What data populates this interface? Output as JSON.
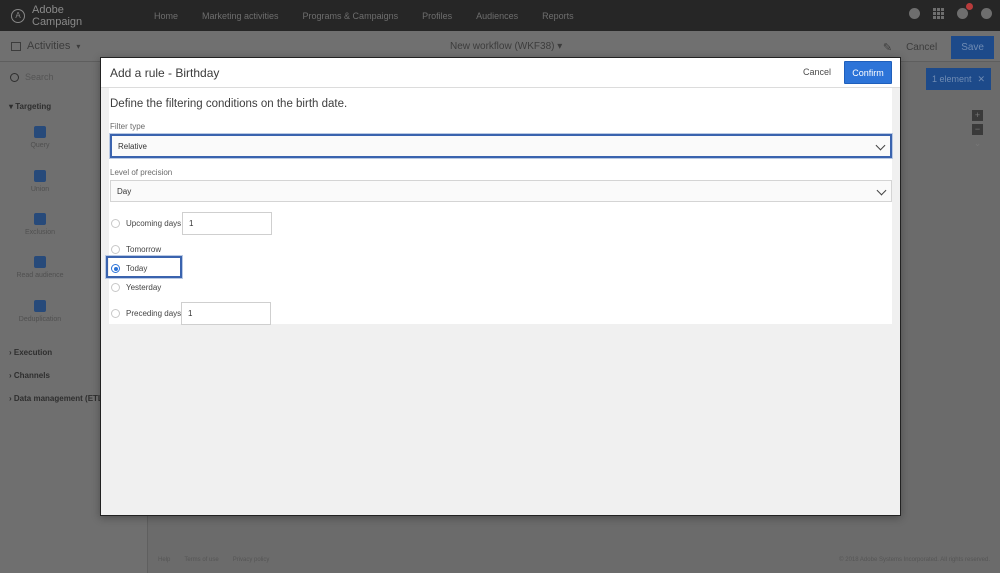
{
  "app": {
    "name": "Adobe Campaign",
    "nav": [
      "Home",
      "Marketing activities",
      "Programs & Campaigns",
      "Profiles",
      "Audiences",
      "Reports"
    ]
  },
  "workflow": {
    "activities_label": "Activities",
    "title": "New workflow (WKF38)",
    "cancel_label": "Cancel",
    "save_label": "Save",
    "search_placeholder": "Search",
    "element_button": "1 element",
    "sections": {
      "targeting": "Targeting",
      "execution": "Execution",
      "channels": "Channels",
      "data_management": "Data management (ETL)"
    },
    "palette": [
      "Query",
      "Union",
      "Exclusion",
      "Read audience",
      "Deduplication"
    ],
    "footer_links": [
      "Help",
      "Terms of use",
      "Privacy policy"
    ],
    "footer_right": "© 2018 Adobe Systems Incorporated. All rights reserved."
  },
  "modal": {
    "title": "Add a rule - Birthday",
    "cancel_label": "Cancel",
    "confirm_label": "Confirm",
    "intro": "Define the filtering conditions on the birth date.",
    "filter_type_label": "Filter type",
    "filter_type_value": "Relative",
    "precision_label": "Level of precision",
    "precision_value": "Day",
    "options": {
      "upcoming_days": "Upcoming days",
      "upcoming_days_value": "1",
      "tomorrow": "Tomorrow",
      "today": "Today",
      "yesterday": "Yesterday",
      "preceding_days": "Preceding days",
      "preceding_days_value": "1"
    },
    "selected_option": "today"
  },
  "colors": {
    "primary_blue": "#2d74d8",
    "focus_outline": "#3a63ae",
    "dim_overlay": "#6b6b6b"
  }
}
